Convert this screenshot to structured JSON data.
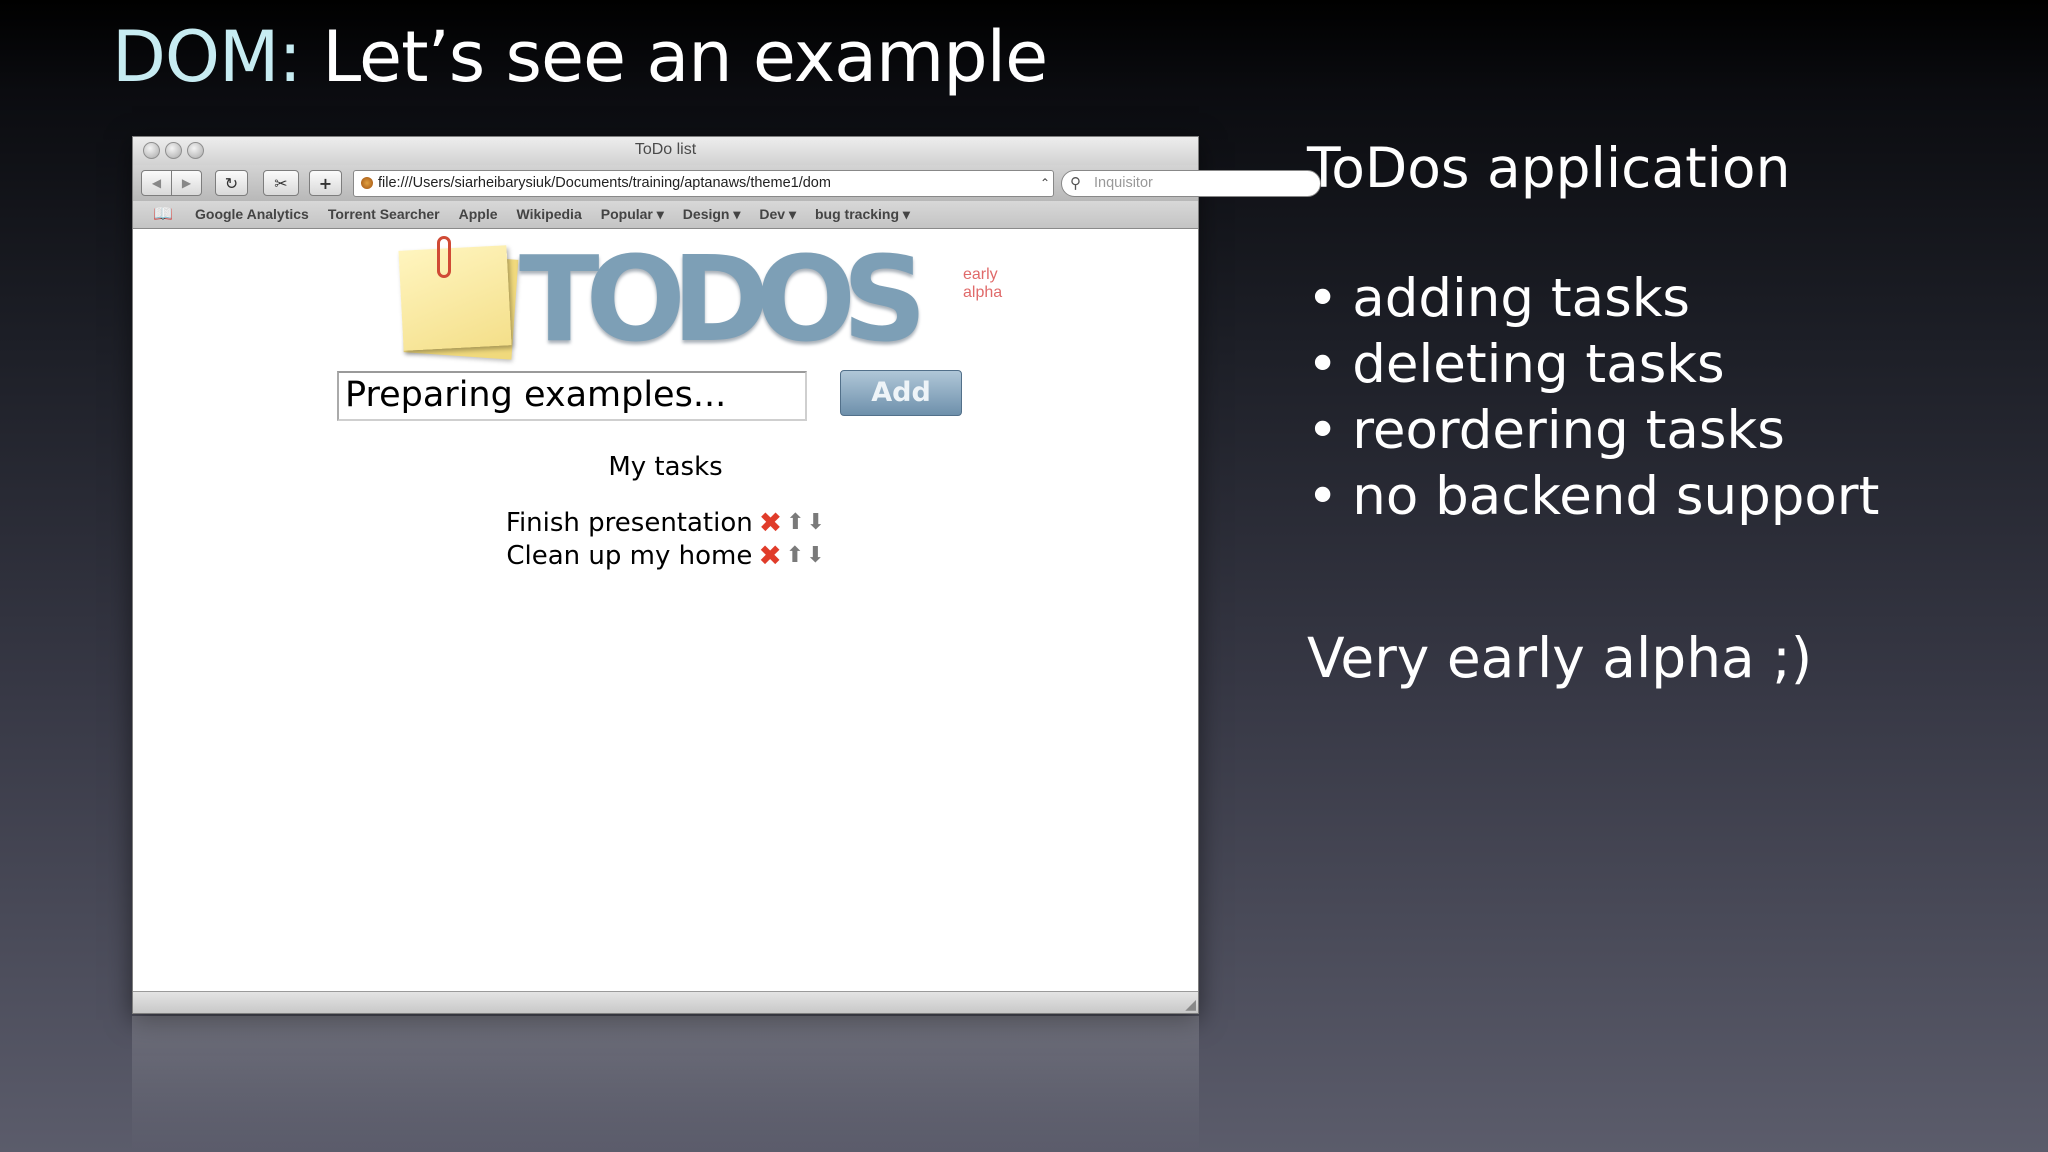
{
  "slide": {
    "title_accent": "DOM:",
    "title_rest": " Let’s see an example",
    "right_heading": "ToDos application",
    "bullets": [
      "adding tasks",
      "deleting tasks",
      "reordering tasks",
      "no backend support"
    ],
    "closing": "Very early alpha ;)"
  },
  "browser": {
    "window_title": "ToDo list",
    "url": "file:///Users/siarheibarysiuk/Documents/training/aptanaws/theme1/dom",
    "search_placeholder": "Inquisitor",
    "bookmarks": [
      "Google Analytics",
      "Torrent Searcher",
      "Apple",
      "Wikipedia",
      "Popular ▾",
      "Design ▾",
      "Dev ▾",
      "bug tracking ▾"
    ],
    "toolbar": {
      "back": "◀",
      "forward": "▶",
      "reload": "↻",
      "snippet": "✂",
      "add": "+"
    }
  },
  "app": {
    "logo": "TODOS",
    "logo_tag": "early alpha",
    "input_value": "Preparing examples...",
    "add_label": "Add",
    "tasks_heading": "My tasks",
    "tasks": [
      "Finish presentation",
      "Clean up my home"
    ]
  },
  "colors": {
    "title_accent": "#c7ecf2",
    "add_button": "#7d9fb6",
    "delete_icon": "#e03c2a",
    "logo_tag": "#e06a6a"
  },
  "icons": {
    "delete": "✖",
    "up": "⬆",
    "down": "⬇"
  }
}
